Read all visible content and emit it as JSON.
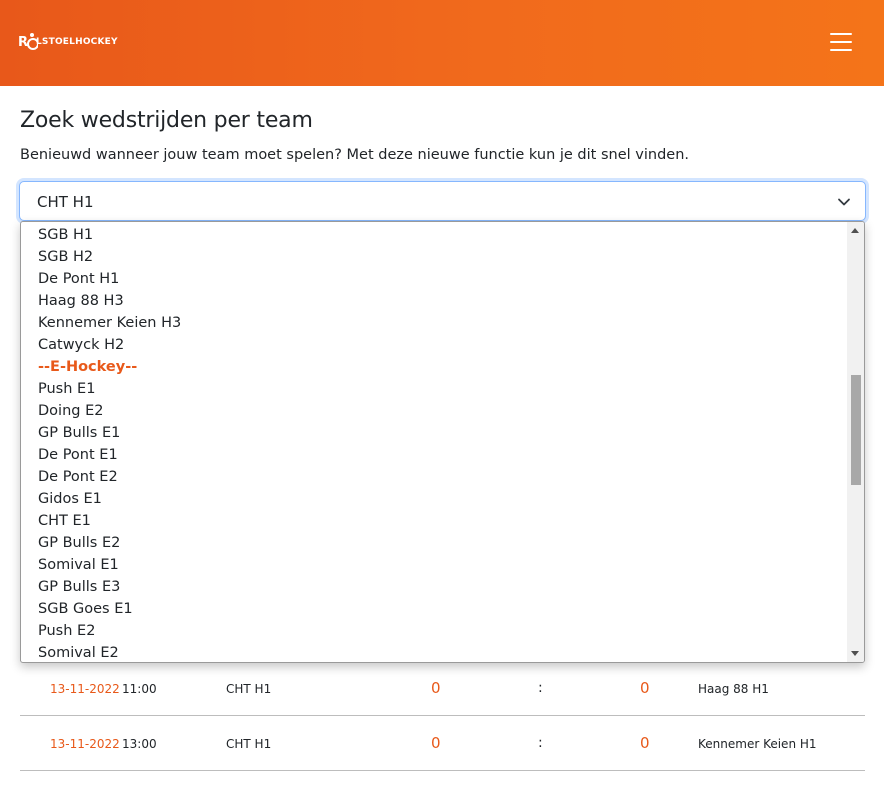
{
  "header": {
    "logo_text": "RO LSTOELHOCKEY",
    "brand_colors": {
      "orange_start": "#e8581a",
      "orange_end": "#f47419"
    },
    "menu_icon": "hamburger-icon"
  },
  "page": {
    "title": "Zoek wedstrijden per team",
    "subtitle": "Benieuwd wanneer jouw team moet spelen? Met deze nieuwe functie kun je dit snel vinden."
  },
  "team_select": {
    "selected": "CHT H1",
    "icon": "chevron-down-icon",
    "options": [
      {
        "label": "SGB H1",
        "group": false
      },
      {
        "label": "SGB H2",
        "group": false
      },
      {
        "label": "De Pont H1",
        "group": false
      },
      {
        "label": "Haag 88 H3",
        "group": false
      },
      {
        "label": "Kennemer Keien H3",
        "group": false
      },
      {
        "label": "Catwyck H2",
        "group": false
      },
      {
        "label": "--E-Hockey--",
        "group": true
      },
      {
        "label": "Push E1",
        "group": false
      },
      {
        "label": "Doing E2",
        "group": false
      },
      {
        "label": "GP Bulls E1",
        "group": false
      },
      {
        "label": "De Pont E1",
        "group": false
      },
      {
        "label": "De Pont E2",
        "group": false
      },
      {
        "label": "Gidos E1",
        "group": false
      },
      {
        "label": "CHT E1",
        "group": false
      },
      {
        "label": "GP Bulls E2",
        "group": false
      },
      {
        "label": "Somival E1",
        "group": false
      },
      {
        "label": "GP Bulls E3",
        "group": false
      },
      {
        "label": "SGB Goes E1",
        "group": false
      },
      {
        "label": "Push E2",
        "group": false
      },
      {
        "label": "Somival E2",
        "group": false
      }
    ]
  },
  "matches": [
    {
      "date": "13-11-2022",
      "time": "11:00",
      "home": "CHT H1",
      "score_home": "0",
      "separator": ":",
      "score_away": "0",
      "away": "Haag 88 H1"
    },
    {
      "date": "13-11-2022",
      "time": "13:00",
      "home": "CHT H1",
      "score_home": "0",
      "separator": ":",
      "score_away": "0",
      "away": "Kennemer Keien H1"
    }
  ]
}
